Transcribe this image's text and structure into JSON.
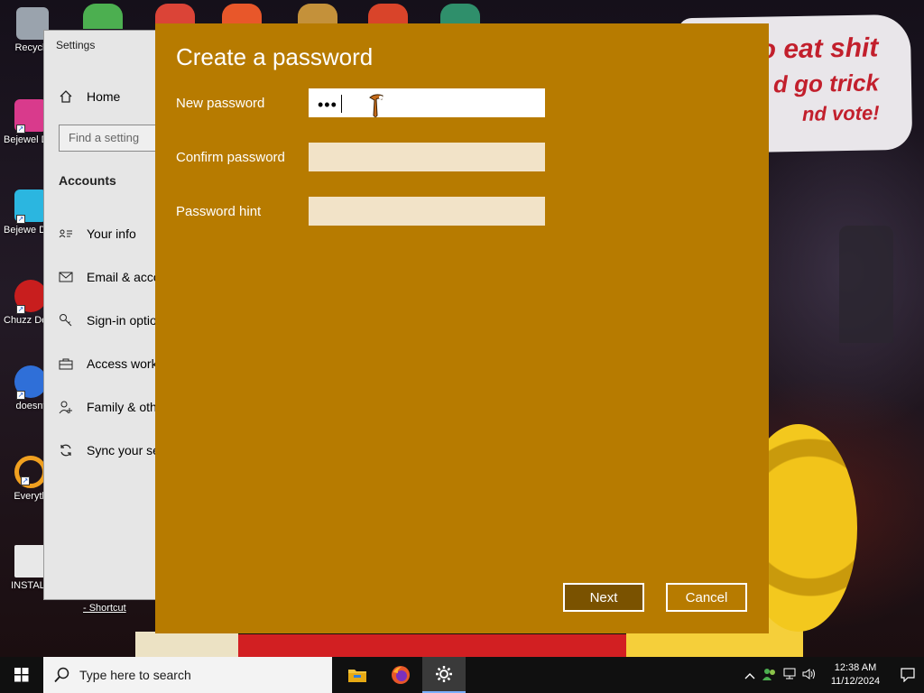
{
  "desktop": {
    "poster_lines": [
      "o eat shit",
      "d go trick",
      "nd vote!"
    ],
    "shortcut_caption": "- Shortcut",
    "icons": [
      {
        "name": "recycle-bin",
        "label": "Recycle"
      },
      {
        "name": "bejeweled-1",
        "label": "Bejewel Delux"
      },
      {
        "name": "bejeweled-2",
        "label": "Bejewe Delux"
      },
      {
        "name": "chuzzle",
        "label": "Chuzz Delux"
      },
      {
        "name": "doesnt",
        "label": "doesnt"
      },
      {
        "name": "everything",
        "label": "Everyth"
      },
      {
        "name": "install",
        "label": "INSTALL"
      }
    ]
  },
  "settings": {
    "window_title": "Settings",
    "home_label": "Home",
    "search_placeholder": "Find a setting",
    "section": "Accounts",
    "nav": [
      {
        "label": "Your info"
      },
      {
        "label": "Email & accounts"
      },
      {
        "label": "Sign-in options"
      },
      {
        "label": "Access work or school"
      },
      {
        "label": "Family & other users"
      },
      {
        "label": "Sync your settings"
      }
    ]
  },
  "dialog": {
    "title": "Create a password",
    "fields": {
      "new_password": {
        "label": "New password",
        "value": "•••"
      },
      "confirm_password": {
        "label": "Confirm password",
        "value": ""
      },
      "password_hint": {
        "label": "Password hint",
        "value": ""
      }
    },
    "buttons": {
      "next": "Next",
      "cancel": "Cancel"
    },
    "accent": "#b77b00"
  },
  "taskbar": {
    "search_placeholder": "Type here to search",
    "time": "12:38 AM",
    "date": "11/12/2024"
  }
}
